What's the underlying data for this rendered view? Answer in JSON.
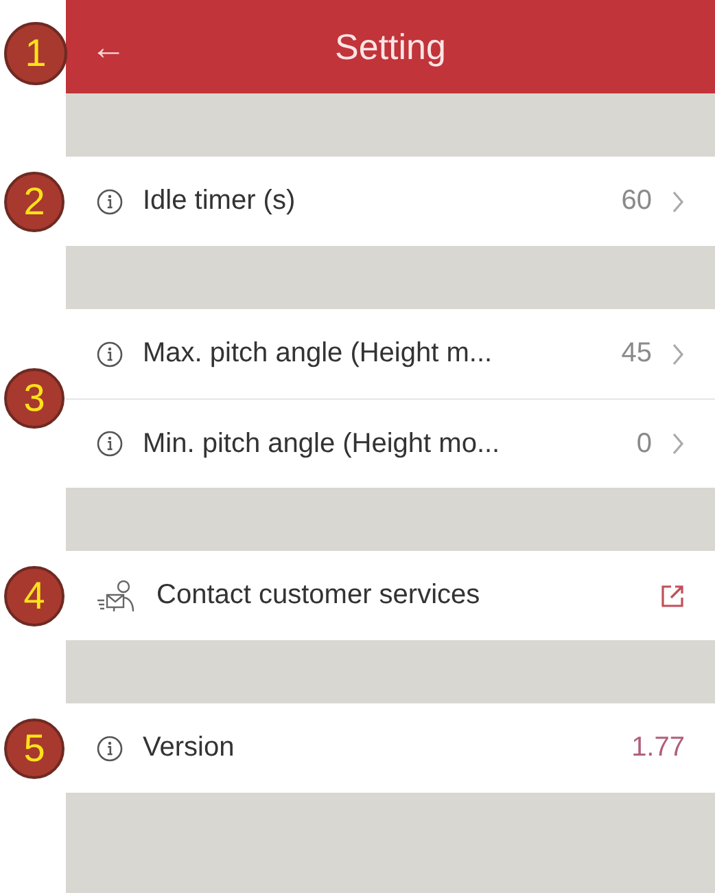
{
  "header": {
    "back": "←",
    "title": "Setting",
    "callout": "1"
  },
  "groups": [
    {
      "callout": "2",
      "rows": [
        {
          "kind": "setting",
          "label": "Idle timer (s)",
          "value": "60"
        }
      ]
    },
    {
      "callout": "3",
      "rows": [
        {
          "kind": "setting",
          "label": "Max. pitch angle (Height m...",
          "value": "45"
        },
        {
          "kind": "setting",
          "label": "Min. pitch angle (Height mo...",
          "value": "0"
        }
      ]
    },
    {
      "callout": "4",
      "rows": [
        {
          "kind": "contact",
          "label": "Contact customer services"
        }
      ]
    },
    {
      "callout": "5",
      "rows": [
        {
          "kind": "version",
          "label": "Version",
          "value": "1.77"
        }
      ]
    }
  ]
}
